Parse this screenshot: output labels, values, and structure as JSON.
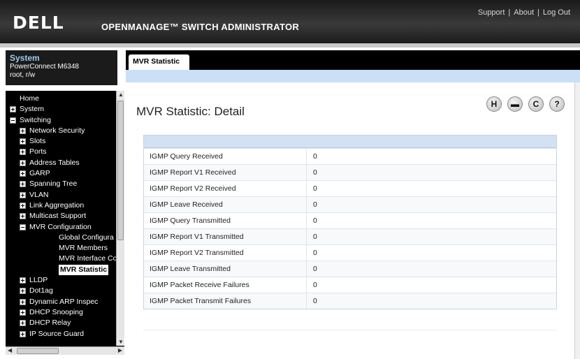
{
  "header": {
    "logo": "DELL",
    "app_title": "OPENMANAGE™ SWITCH ADMINISTRATOR",
    "links": [
      "Support",
      "About",
      "Log Out"
    ],
    "separator": "|"
  },
  "system": {
    "title": "System",
    "model": "PowerConnect M6348",
    "user": "root, r/w"
  },
  "nav": {
    "items": [
      {
        "label": "Home",
        "level": 0,
        "toggle": "none"
      },
      {
        "label": "System",
        "level": 0,
        "toggle": "plus"
      },
      {
        "label": "Switching",
        "level": 0,
        "toggle": "minus"
      },
      {
        "label": "Network Security",
        "level": 1,
        "toggle": "plus"
      },
      {
        "label": "Slots",
        "level": 1,
        "toggle": "plus"
      },
      {
        "label": "Ports",
        "level": 1,
        "toggle": "plus"
      },
      {
        "label": "Address Tables",
        "level": 1,
        "toggle": "plus"
      },
      {
        "label": "GARP",
        "level": 1,
        "toggle": "plus"
      },
      {
        "label": "Spanning Tree",
        "level": 1,
        "toggle": "plus"
      },
      {
        "label": "VLAN",
        "level": 1,
        "toggle": "plus"
      },
      {
        "label": "Link Aggregation",
        "level": 1,
        "toggle": "plus"
      },
      {
        "label": "Multicast Support",
        "level": 1,
        "toggle": "plus"
      },
      {
        "label": "MVR Configuration",
        "level": 1,
        "toggle": "minus"
      },
      {
        "label": "Global Configura",
        "level": 2,
        "toggle": "none"
      },
      {
        "label": "MVR Members",
        "level": 2,
        "toggle": "none"
      },
      {
        "label": "MVR Interface Co",
        "level": 2,
        "toggle": "none"
      },
      {
        "label": "MVR Statistic",
        "level": 2,
        "toggle": "none",
        "active": true
      },
      {
        "label": "LLDP",
        "level": 1,
        "toggle": "plus"
      },
      {
        "label": "Dot1ag",
        "level": 1,
        "toggle": "plus"
      },
      {
        "label": "Dynamic ARP Inspec",
        "level": 1,
        "toggle": "plus"
      },
      {
        "label": "DHCP Snooping",
        "level": 1,
        "toggle": "plus"
      },
      {
        "label": "DHCP Relay",
        "level": 1,
        "toggle": "plus"
      },
      {
        "label": "IP Source Guard",
        "level": 1,
        "toggle": "plus"
      }
    ]
  },
  "tab": {
    "label": "MVR Statistic"
  },
  "page": {
    "title": "MVR Statistic: Detail"
  },
  "toolbar": {
    "buttons": [
      {
        "name": "help-h-button",
        "glyph": "H"
      },
      {
        "name": "print-button",
        "glyph": "▬"
      },
      {
        "name": "refresh-button",
        "glyph": "C"
      },
      {
        "name": "help-question-button",
        "glyph": "?"
      }
    ]
  },
  "table": {
    "rows": [
      {
        "label": "IGMP Query Received",
        "value": "0"
      },
      {
        "label": "IGMP Report V1 Received",
        "value": "0"
      },
      {
        "label": "IGMP Report V2 Received",
        "value": "0"
      },
      {
        "label": "IGMP Leave Received",
        "value": "0"
      },
      {
        "label": "IGMP Query Transmitted",
        "value": "0"
      },
      {
        "label": "IGMP Report V1 Transmitted",
        "value": "0"
      },
      {
        "label": "IGMP Report V2 Transmitted",
        "value": "0"
      },
      {
        "label": "IGMP Leave Transmitted",
        "value": "0"
      },
      {
        "label": "IGMP Packet Receive Failures",
        "value": "0"
      },
      {
        "label": "IGMP Packet Transmit Failures",
        "value": "0"
      }
    ]
  }
}
